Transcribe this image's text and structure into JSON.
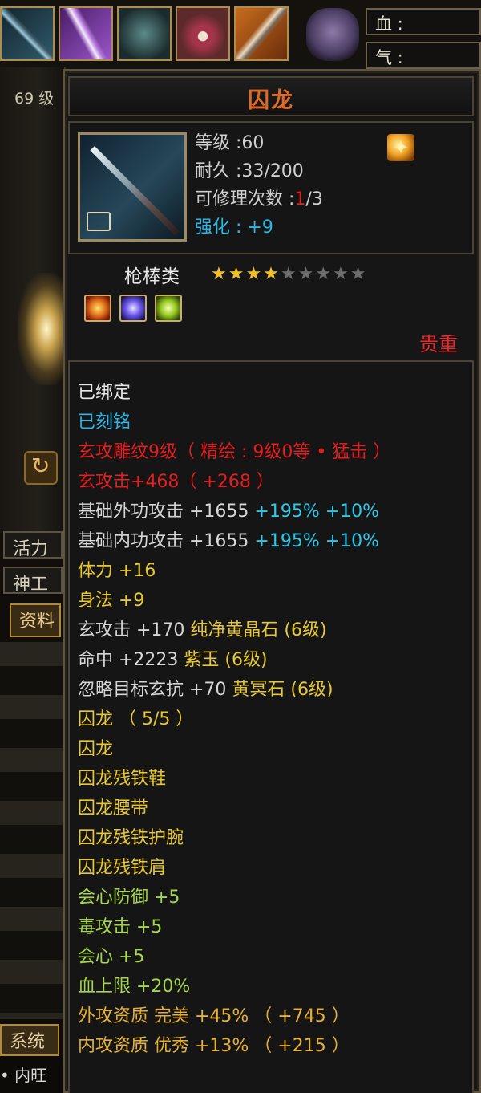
{
  "equip_bar": {
    "slots": [
      "spear-slot",
      "blade-slot",
      "armor-slot",
      "necklace-slot",
      "dagger-slot"
    ]
  },
  "status": {
    "blood_label": "血 :",
    "qi_label": "气 :"
  },
  "side": {
    "level_text": "69 级",
    "tab_vitality": "活力",
    "tab_shengong": "神工",
    "tab_info": "资料",
    "tab_system": "系统",
    "bottom_text": "• 内旺"
  },
  "item": {
    "name": "囚龙",
    "level_label": "等级 :",
    "level": "60",
    "durability_label": "耐久 :",
    "durability": "33/200",
    "repair_label": "可修理次数 :",
    "repair_used": "1",
    "repair_total": "/3",
    "enhance_label": "强化 :",
    "enhance_value": "+9",
    "category": "枪棒类",
    "stars_filled": 4,
    "stars_total": 9,
    "star_on_glyph": "★★★★",
    "star_off_glyph": "★★★★★",
    "rarity": "贵重",
    "badge_icon": "flame-badge-icon"
  },
  "attributes": [
    {
      "text": "已绑定",
      "color": "white"
    },
    {
      "text": "已刻铭",
      "color": "cyan"
    },
    {
      "text": "玄攻雕纹9级（ 精绘 : 9级0等 • 猛击 ）",
      "color": "red"
    },
    {
      "text": "玄攻击+468（ +268 ）",
      "color": "red"
    }
  ],
  "base_attack": [
    {
      "label": "基础外功攻击  +1655",
      "pct1": " +195%",
      "pct2": " +10%"
    },
    {
      "label": "基础内功攻击  +1655",
      "pct1": " +195%",
      "pct2": " +10%"
    }
  ],
  "bonus_lines": [
    {
      "text": "体力  +16",
      "color": "yellow"
    },
    {
      "text": "身法  +9",
      "color": "yellow"
    }
  ],
  "gem_lines": [
    {
      "label": "玄攻击  +170  ",
      "gem": "纯净黄晶石 (6级)"
    },
    {
      "label": "命中  +2223  ",
      "gem": "紫玉 (6级)"
    },
    {
      "label": "忽略目标玄抗  +70  ",
      "gem": "黄冥石 (6级)"
    }
  ],
  "set_lines": [
    {
      "text": "囚龙  （ 5/5 ）"
    },
    {
      "text": "囚龙"
    },
    {
      "text": "囚龙残铁鞋"
    },
    {
      "text": "囚龙腰带"
    },
    {
      "text": "囚龙残铁护腕"
    },
    {
      "text": "囚龙残铁肩"
    }
  ],
  "set_bonus": [
    {
      "text": "会心防御  +5"
    },
    {
      "text": "毒攻击  +5"
    },
    {
      "text": "会心  +5"
    },
    {
      "text": "血上限  +20%"
    }
  ],
  "aptitude": [
    {
      "text": "外攻资质    完美  +45%  （ +745 ）"
    },
    {
      "text": "内攻资质    优秀  +13%  （ +215 ）"
    }
  ],
  "colors": {
    "title": "#e06a25",
    "red": "#e41e1e",
    "cyan": "#2ab6e6",
    "yellow": "#e8c830",
    "green": "#a6d64a",
    "orange": "#e6b030"
  }
}
